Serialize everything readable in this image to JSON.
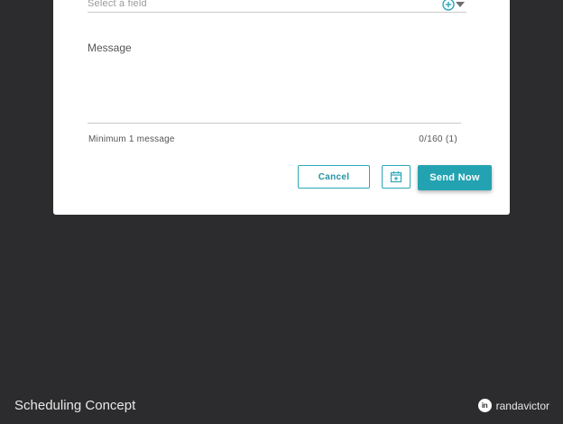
{
  "dialog": {
    "field_select": {
      "placeholder": "Select a field"
    },
    "message": {
      "label": "Message",
      "value": "",
      "helper": "Minimum 1 message",
      "counter": "0/160 (1)"
    },
    "actions": {
      "cancel_label": "Cancel",
      "send_label": "Send Now"
    }
  },
  "footer": {
    "title": "Scheduling Concept",
    "brand_icon": "in",
    "brand_name": "randavictor"
  },
  "colors": {
    "accent": "#23a3b1",
    "background": "#2c2c2e",
    "card": "#ffffff"
  },
  "icons": {
    "add": "plus-circle-icon",
    "schedule": "calendar-icon",
    "dropdown": "chevron-down-icon",
    "brand": "linkedin-icon"
  }
}
